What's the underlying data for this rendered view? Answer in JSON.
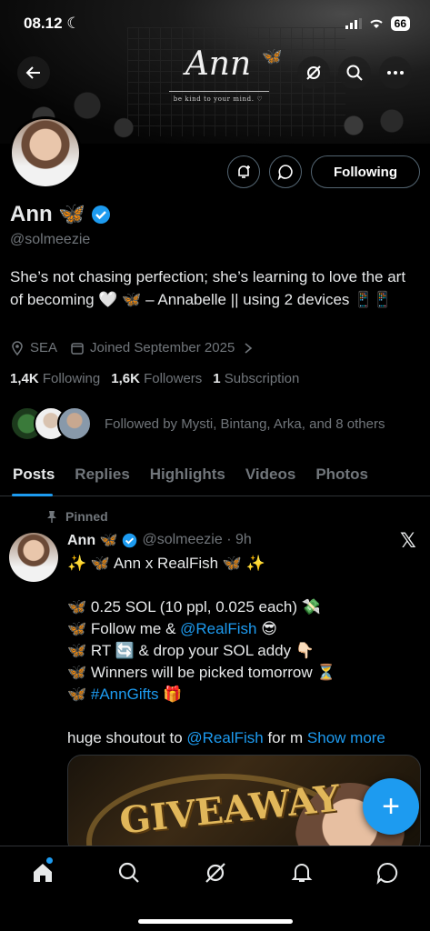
{
  "status_bar": {
    "time": "08.12",
    "battery": "66"
  },
  "banner": {
    "logo_text": "Ann",
    "tagline": "be kind to your mind. ♡"
  },
  "profile": {
    "name": "Ann 🦋",
    "handle": "@solmeezie",
    "bio": "She’s not chasing perfection; she’s learning to love the art of becoming 🤍 🦋 – Annabelle || using 2 devices 📱📱",
    "location": "SEA",
    "joined": "Joined September 2025",
    "following_button": "Following",
    "stats": {
      "following_count": "1,4K",
      "following_label": "Following",
      "followers_count": "1,6K",
      "followers_label": "Followers",
      "subscription_count": "1",
      "subscription_label": "Subscription"
    },
    "followed_by": "Followed by Mysti, Bintang, Arka, and 8 others"
  },
  "tabs": [
    "Posts",
    "Replies",
    "Highlights",
    "Videos",
    "Photos"
  ],
  "active_tab": "Posts",
  "post": {
    "pinned_label": "Pinned",
    "name": "Ann 🦋",
    "handle_time": "@solmeezie · 9h",
    "lines": {
      "l1": "✨ 🦋 Ann x RealFish 🦋 ✨",
      "l2": "🦋 0.25 SOL (10 ppl, 0.025 each) 💸",
      "l3_pre": "🦋 Follow me & ",
      "l3_link": "@RealFish",
      "l3_post": " 😎",
      "l4": "🦋 RT 🔄 & drop your SOL addy 👇🏻",
      "l5": "🦋 Winners will be picked tomorrow ⏳",
      "l6_pre": "🦋 ",
      "l6_link": "#AnnGifts",
      "l6_post": " 🎁",
      "l7_pre": "huge shoutout to ",
      "l7_link": "@RealFish",
      "l7_post": " for m ",
      "show_more": "Show more"
    },
    "media_text": "GIVEAWAY"
  },
  "fab_label": "+",
  "colors": {
    "accent": "#1d9bf0",
    "muted": "#71767b",
    "text": "#e7e9ea",
    "border": "#2f3336"
  },
  "icons": {
    "back": "back-arrow-icon",
    "grok": "grok-icon",
    "search": "search-icon",
    "more": "more-icon",
    "notify": "bell-plus-icon",
    "message": "message-icon",
    "verified": "verified-badge-icon",
    "nav": [
      "home-icon",
      "search-icon",
      "grok-icon",
      "bell-icon",
      "message-icon"
    ]
  }
}
